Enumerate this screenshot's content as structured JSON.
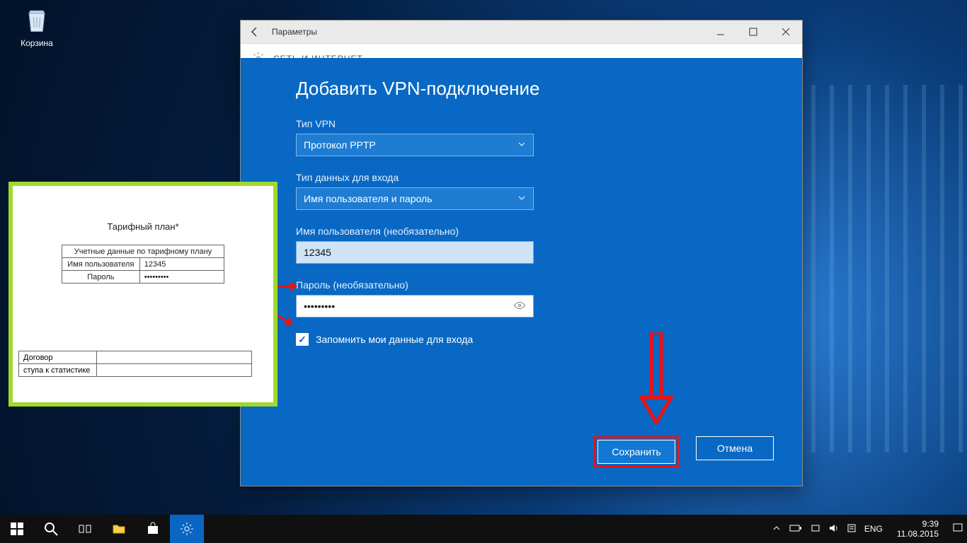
{
  "desktop": {
    "recycle_bin_label": "Корзина"
  },
  "window": {
    "title": "Параметры",
    "subheader": "СЕТЬ И ИНТЕРНЕТ"
  },
  "vpn": {
    "title": "Добавить VPN-подключение",
    "fields": {
      "type_label": "Тип VPN",
      "type_value": "Протокол PPTP",
      "auth_label": "Тип данных для входа",
      "auth_value": "Имя пользователя и пароль",
      "user_label": "Имя пользователя (необязательно)",
      "user_value": "12345",
      "pass_label": "Пароль (необязательно)",
      "pass_value": "•••••••••",
      "remember_label": "Запомнить мои данные для входа"
    },
    "buttons": {
      "save": "Сохранить",
      "cancel": "Отмена"
    }
  },
  "doc": {
    "heading": "Тарифный план*",
    "table_title": "Учетные данные по тарифному плану",
    "row_user_k": "Имя пользователя",
    "row_user_v": "12345",
    "row_pass_k": "Пароль",
    "row_pass_v": "•••••••••",
    "lower_row1": "Договор",
    "lower_row2": "ступа к статистике"
  },
  "taskbar": {
    "lang": "ENG",
    "time": "9:39",
    "date": "11.08.2015"
  }
}
